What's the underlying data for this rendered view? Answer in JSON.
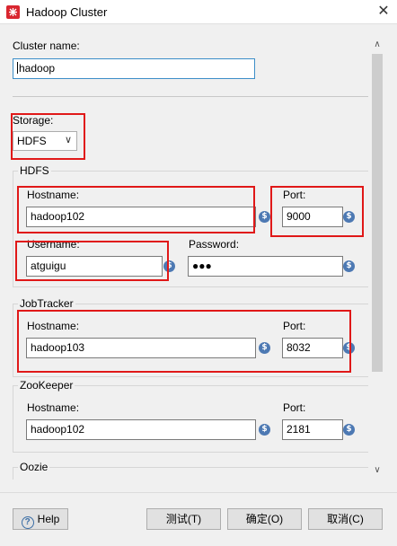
{
  "window": {
    "title": "Hadoop Cluster",
    "close": "✕"
  },
  "cluster": {
    "label": "Cluster name:",
    "value": "hadoop"
  },
  "storage": {
    "label": "Storage:",
    "selected": "HDFS"
  },
  "hdfs": {
    "title": "HDFS",
    "hostname_label": "Hostname:",
    "hostname_value": "hadoop102",
    "port_label": "Port:",
    "port_value": "9000",
    "username_label": "Username:",
    "username_value": "atguigu",
    "password_label": "Password:",
    "password_value": "●●●"
  },
  "jobtracker": {
    "title": "JobTracker",
    "hostname_label": "Hostname:",
    "hostname_value": "hadoop103",
    "port_label": "Port:",
    "port_value": "8032"
  },
  "zookeeper": {
    "title": "ZooKeeper",
    "hostname_label": "Hostname:",
    "hostname_value": "hadoop102",
    "port_label": "Port:",
    "port_value": "2181"
  },
  "oozie": {
    "title": "Oozie"
  },
  "variable_icon_glyph": "$",
  "footer": {
    "help_label": "Help",
    "help_icon_glyph": "?",
    "test_label": "测试(T)",
    "ok_label": "确定(O)",
    "cancel_label": "取消(C)"
  },
  "colors": {
    "highlight": "#e01818",
    "variable_icon": "#4d79b3",
    "focus_border": "#3c8ec8"
  }
}
